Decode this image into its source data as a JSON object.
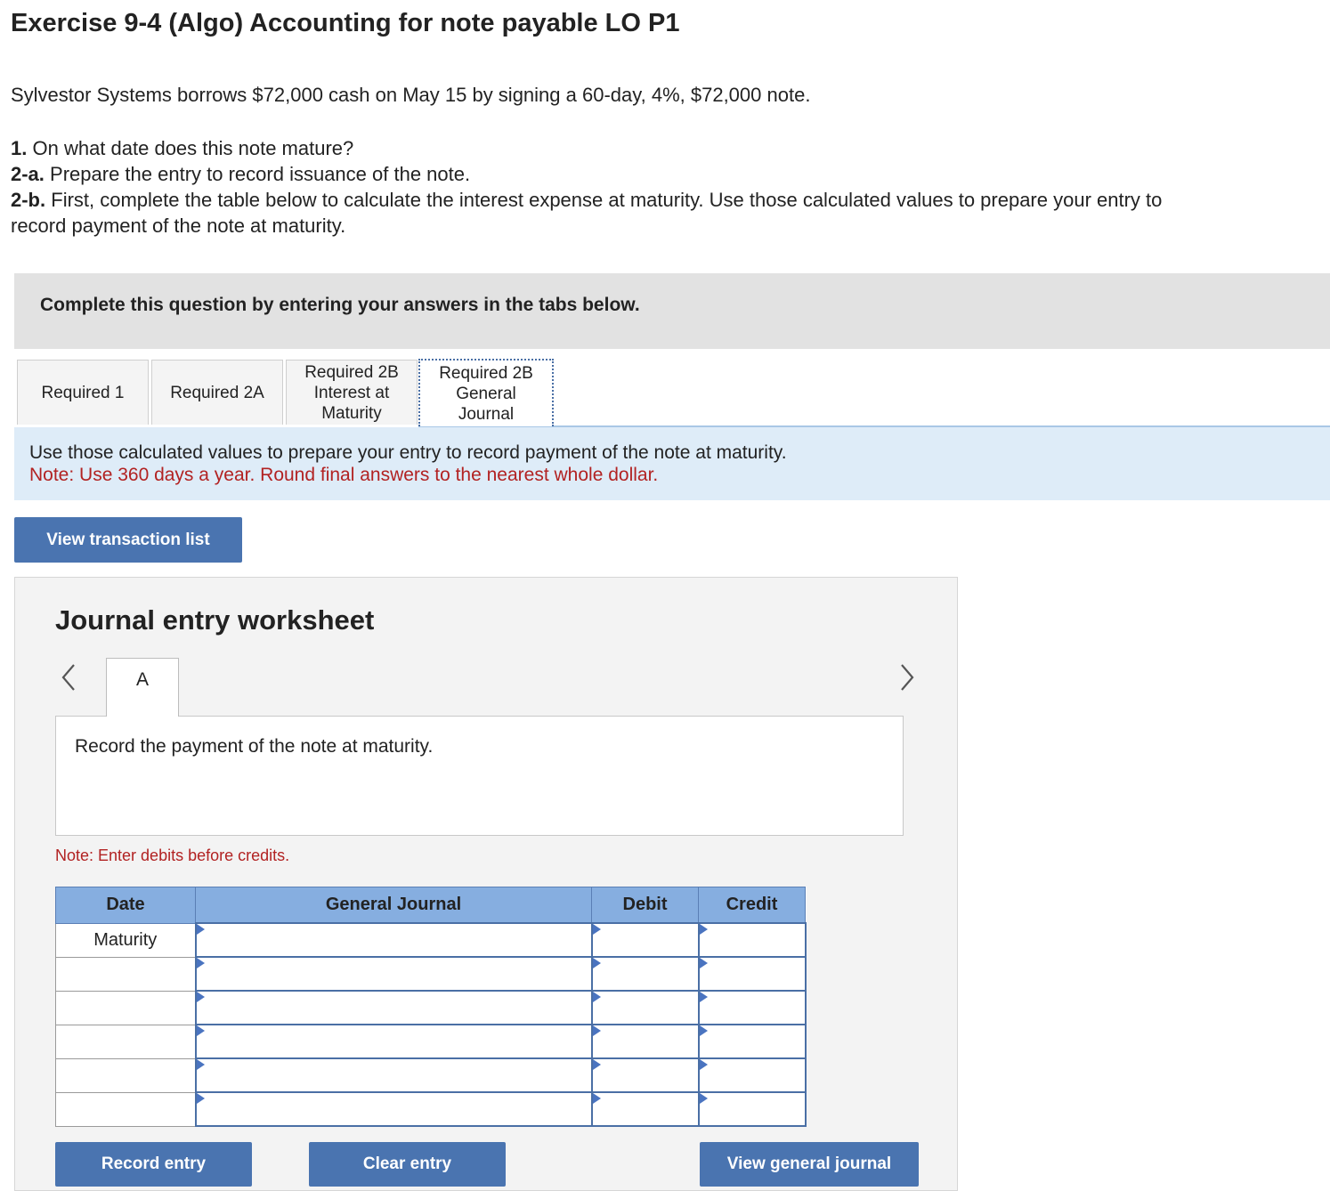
{
  "header": {
    "title": "Exercise 9-4 (Algo) Accounting for note payable LO P1",
    "intro": "Sylvestor Systems borrows $72,000 cash on May 15 by signing a 60-day, 4%, $72,000 note."
  },
  "questions": [
    {
      "num": "1.",
      "text": "On what date does this note mature?"
    },
    {
      "num": "2-a.",
      "text": "Prepare the entry to record issuance of the note."
    },
    {
      "num": "2-b.",
      "text": "First, complete the table below to calculate the interest expense at maturity. Use those calculated values to prepare your entry to"
    },
    {
      "num": "",
      "text": "record payment of the note at maturity."
    }
  ],
  "instruction": "Complete this question by entering your answers in the tabs below.",
  "tabs": [
    {
      "label": "Required 1"
    },
    {
      "label": "Required 2A"
    },
    {
      "label": "Required 2B Interest at Maturity",
      "lines": [
        "Required 2B",
        "Interest at",
        "Maturity"
      ]
    },
    {
      "label": "Required 2B General Journal",
      "lines": [
        "Required 2B",
        "General",
        "Journal"
      ],
      "active": true
    }
  ],
  "info": {
    "line1": "Use those calculated values to prepare your entry to record payment of the note at maturity.",
    "line2": "Note: Use 360 days a year. Round final answers to the nearest whole dollar."
  },
  "buttons": {
    "view_transactions": "View transaction list",
    "record_entry": "Record entry",
    "clear_entry": "Clear entry",
    "view_general_journal": "View general journal"
  },
  "worksheet": {
    "title": "Journal entry worksheet",
    "entry_tab": "A",
    "entry_description": "Record the payment of the note at maturity.",
    "note": "Note: Enter debits before credits.",
    "columns": [
      "Date",
      "General Journal",
      "Debit",
      "Credit"
    ],
    "rows": [
      {
        "date": "Maturity"
      },
      {
        "date": ""
      },
      {
        "date": ""
      },
      {
        "date": ""
      },
      {
        "date": ""
      },
      {
        "date": ""
      }
    ]
  },
  "colors": {
    "accent": "#4a74b0",
    "header_row": "#86aee0",
    "note_red": "#b22222",
    "info_band": "#deecf8"
  }
}
